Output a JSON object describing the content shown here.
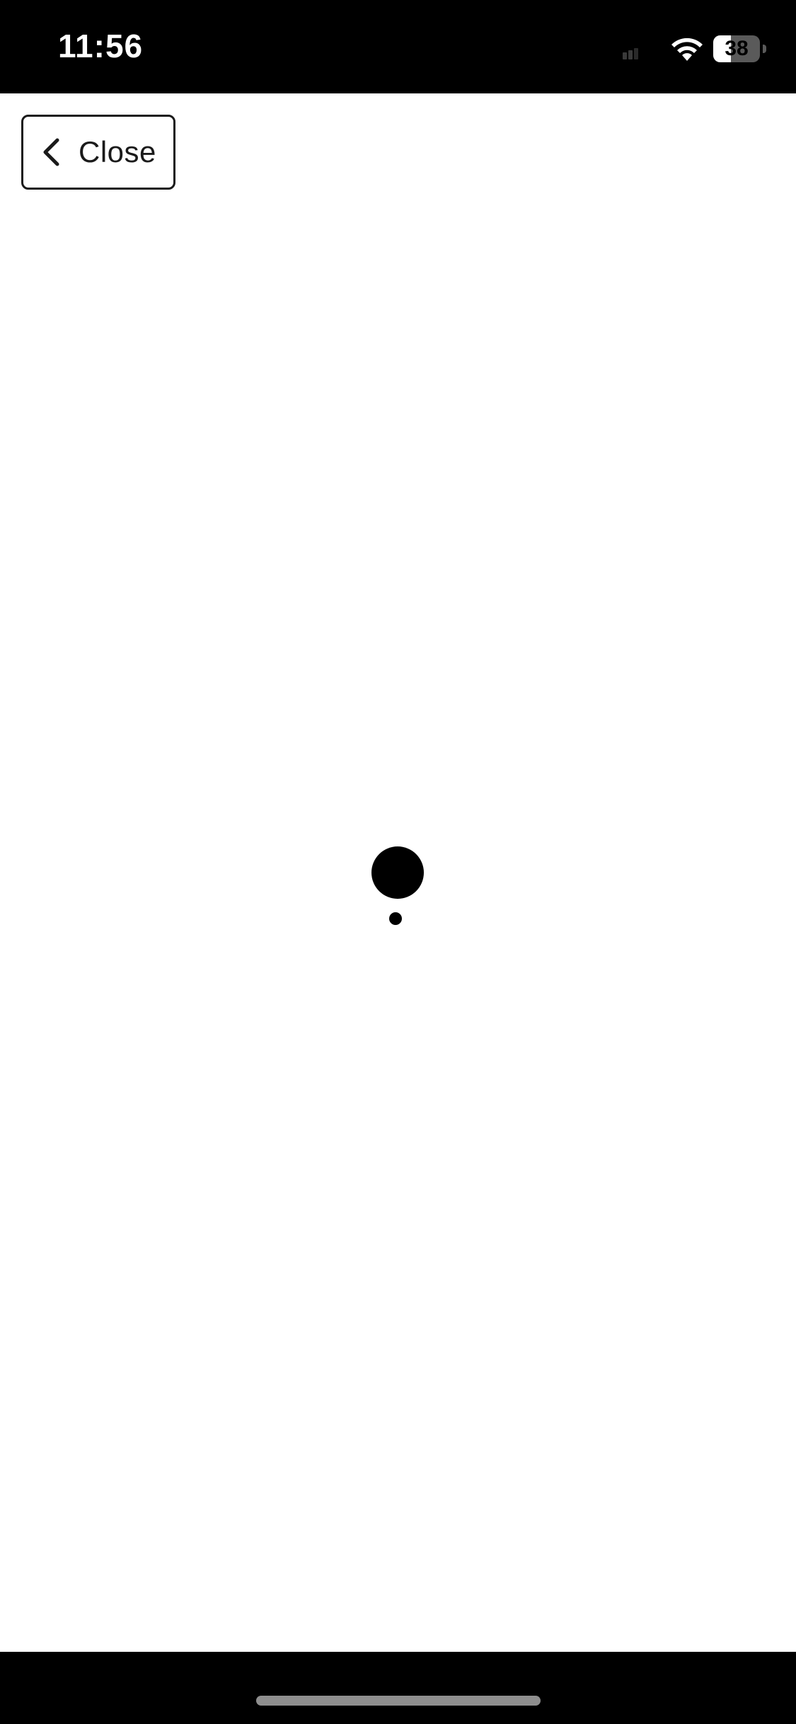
{
  "status_bar": {
    "time": "11:56",
    "battery_level": "38",
    "battery_fraction": 0.38,
    "icons": [
      "signal-icon",
      "wifi-icon",
      "battery-icon"
    ],
    "background_color": "#000000",
    "text_color": "#ffffff"
  },
  "header": {
    "close_label": "Close",
    "close_icon": "chevron-left-icon"
  },
  "main": {
    "state": "loading",
    "indicator": "bouncing-ball-loader",
    "indicator_color": "#000000"
  },
  "footer": {
    "home_indicator_color": "#8e8e8e",
    "background_color": "#000000"
  }
}
